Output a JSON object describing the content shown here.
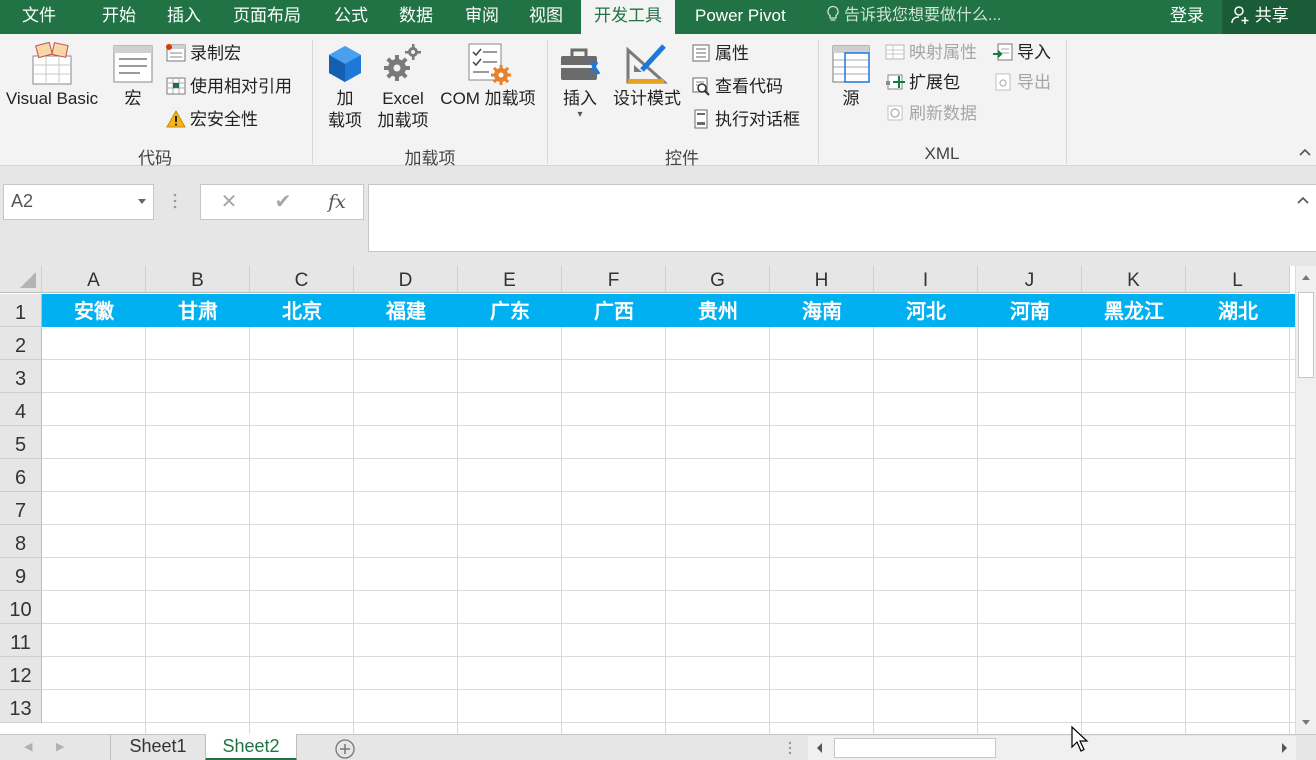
{
  "ribbon_tabs": [
    {
      "label": "文件"
    },
    {
      "label": "开始"
    },
    {
      "label": "插入"
    },
    {
      "label": "页面布局"
    },
    {
      "label": "公式"
    },
    {
      "label": "数据"
    },
    {
      "label": "审阅"
    },
    {
      "label": "视图"
    },
    {
      "label": "开发工具",
      "active": true
    },
    {
      "label": "Power Pivot"
    }
  ],
  "tell_me": "告诉我您想要做什么...",
  "account": {
    "login": "登录",
    "share": "共享"
  },
  "groups": {
    "code": {
      "label": "代码",
      "visual_basic": "Visual Basic",
      "macros": "宏",
      "record_macro": "录制宏",
      "relative_refs": "使用相对引用",
      "macro_security": "宏安全性"
    },
    "addins": {
      "label": "加载项",
      "addins_l1": "加",
      "addins_l2": "载项",
      "excel_addins_l1": "Excel",
      "excel_addins_l2": "加载项",
      "com_addins": "COM 加载项"
    },
    "controls": {
      "label": "控件",
      "insert": "插入",
      "design_mode": "设计模式",
      "properties": "属性",
      "view_code": "查看代码",
      "run_dialog": "执行对话框"
    },
    "xml": {
      "label": "XML",
      "source": "源",
      "map_properties": "映射属性",
      "expansion_packs": "扩展包",
      "refresh_data": "刷新数据",
      "import": "导入",
      "export": "导出"
    }
  },
  "formula_bar": {
    "name_box": "A2",
    "formula": "",
    "fx": "fx"
  },
  "columns": [
    "A",
    "B",
    "C",
    "D",
    "E",
    "F",
    "G",
    "H",
    "I",
    "J",
    "K",
    "L"
  ],
  "rows": [
    "1",
    "2",
    "3",
    "4",
    "5",
    "6",
    "7",
    "8",
    "9",
    "10",
    "11",
    "12",
    "13"
  ],
  "header_row": [
    "安徽",
    "甘肃",
    "北京",
    "福建",
    "广东",
    "广西",
    "贵州",
    "海南",
    "河北",
    "河南",
    "黑龙江",
    "湖北"
  ],
  "sheets": [
    {
      "name": "Sheet1"
    },
    {
      "name": "Sheet2",
      "active": true
    }
  ],
  "colors": {
    "excel_green": "#217346",
    "header_fill": "#00b0f0"
  }
}
